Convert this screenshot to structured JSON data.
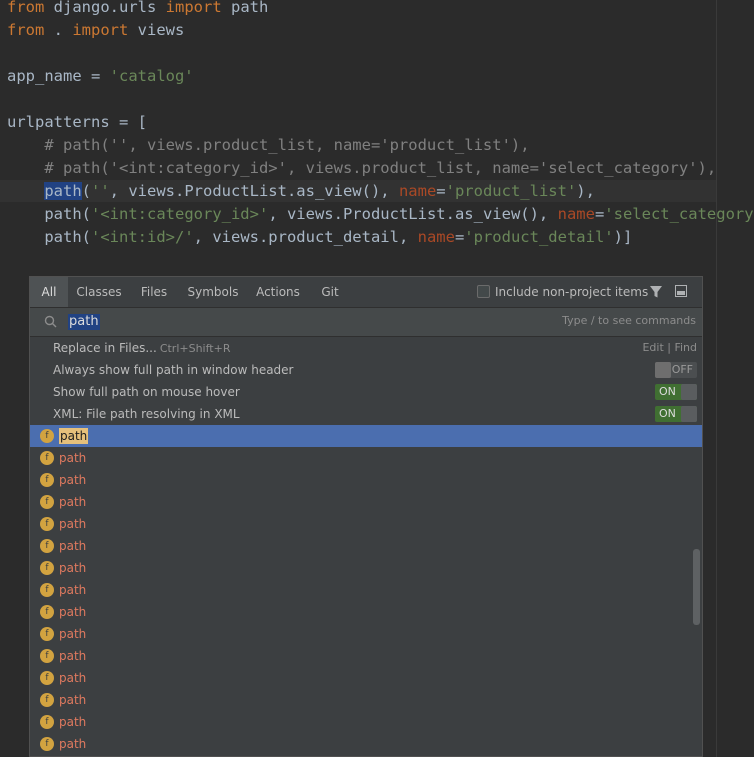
{
  "editor": {
    "lines": [
      {
        "parts": [
          {
            "t": "from",
            "c": "kw"
          },
          {
            "t": " django.urls ",
            "c": ""
          },
          {
            "t": "import",
            "c": "kw"
          },
          {
            "t": " path",
            "c": ""
          }
        ]
      },
      {
        "parts": [
          {
            "t": "from",
            "c": "kw"
          },
          {
            "t": " . ",
            "c": ""
          },
          {
            "t": "import",
            "c": "kw"
          },
          {
            "t": " views",
            "c": ""
          }
        ]
      },
      {
        "parts": []
      },
      {
        "parts": [
          {
            "t": "app_name = ",
            "c": ""
          },
          {
            "t": "'catalog'",
            "c": "str"
          }
        ]
      },
      {
        "parts": []
      },
      {
        "parts": [
          {
            "t": "urlpatterns = [",
            "c": ""
          }
        ]
      },
      {
        "parts": [
          {
            "t": "    # path('', views.product_list, name='product_list'),",
            "c": "cmt"
          }
        ]
      },
      {
        "parts": [
          {
            "t": "    # path('<int:category_id>', views.product_list, name='select_category'),",
            "c": "cmt"
          }
        ]
      },
      {
        "parts": [
          {
            "t": "    ",
            "c": ""
          },
          {
            "t": "path",
            "c": "hl"
          },
          {
            "t": "(",
            "c": ""
          },
          {
            "t": "''",
            "c": "str"
          },
          {
            "t": ", views.ProductList.as_view(), ",
            "c": ""
          },
          {
            "t": "name",
            "c": "param"
          },
          {
            "t": "=",
            "c": ""
          },
          {
            "t": "'product_list'",
            "c": "str"
          },
          {
            "t": "),",
            "c": ""
          }
        ]
      },
      {
        "parts": [
          {
            "t": "    path(",
            "c": ""
          },
          {
            "t": "'<int:category_id>'",
            "c": "str"
          },
          {
            "t": ", views.ProductList.as_view(), ",
            "c": ""
          },
          {
            "t": "name",
            "c": "param"
          },
          {
            "t": "=",
            "c": ""
          },
          {
            "t": "'select_category'",
            "c": "str"
          },
          {
            "t": "),",
            "c": ""
          }
        ]
      },
      {
        "parts": [
          {
            "t": "    path(",
            "c": ""
          },
          {
            "t": "'<int:id>/'",
            "c": "str"
          },
          {
            "t": ", views.product_detail, ",
            "c": ""
          },
          {
            "t": "name",
            "c": "param"
          },
          {
            "t": "=",
            "c": ""
          },
          {
            "t": "'product_detail'",
            "c": "str"
          },
          {
            "t": ")]",
            "c": ""
          }
        ]
      }
    ]
  },
  "popup": {
    "tabs": [
      "All",
      "Classes",
      "Files",
      "Symbols",
      "Actions",
      "Git"
    ],
    "active_tab": "All",
    "include_label": "Include non-project items",
    "search": {
      "query": "path",
      "hint": "Type / to see commands"
    },
    "actions": [
      {
        "label": "Replace in Files...",
        "shortcut": "Ctrl+Shift+R",
        "right": "Edit | Find"
      },
      {
        "label": "Always show full path in window header",
        "toggle": "OFF"
      },
      {
        "label": "Show full path on mouse hover",
        "toggle": "ON"
      },
      {
        "label": "XML: File path resolving in XML",
        "toggle": "ON"
      }
    ],
    "results": [
      "path",
      "path",
      "path",
      "path",
      "path",
      "path",
      "path",
      "path",
      "path",
      "path",
      "path",
      "path",
      "path",
      "path",
      "path"
    ],
    "result_icon": "f",
    "colors": {
      "accent": "#4b6eaf",
      "toggle_on": "#406f32",
      "function_icon": "#d2a340",
      "result_text": "#e07a5f"
    }
  }
}
